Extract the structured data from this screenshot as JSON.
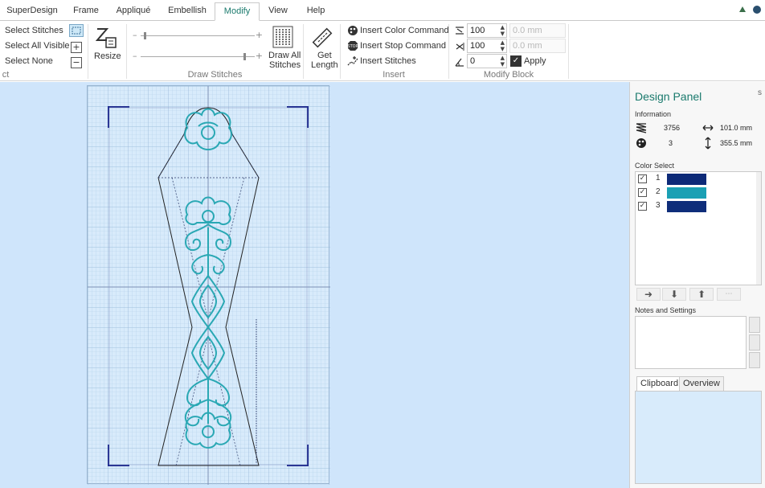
{
  "tabs": [
    {
      "label": "SuperDesign",
      "active": false
    },
    {
      "label": "Frame",
      "active": false
    },
    {
      "label": "Appliqué",
      "active": false
    },
    {
      "label": "Embellish",
      "active": false
    },
    {
      "label": "Modify",
      "active": true
    },
    {
      "label": "View",
      "active": false
    },
    {
      "label": "Help",
      "active": false
    }
  ],
  "ribbon": {
    "select": {
      "select_stitches": "Select Stitches",
      "select_all_visible": "Select All Visible",
      "select_none": "Select None",
      "group_label_fragment": "ct"
    },
    "resize_label": "Resize",
    "draw_all_stitches_line1": "Draw All",
    "draw_all_stitches_line2": "Stitches",
    "draw_stitches_group": "Draw Stitches",
    "get_length_line1": "Get",
    "get_length_line2": "Length",
    "insert_color_command": "Insert Color Command",
    "insert_stop_command": "Insert Stop Command",
    "insert_stitches": "Insert Stitches",
    "insert_group": "Insert",
    "modify_block": {
      "scale_x": "100",
      "scale_y": "100",
      "angle": "0",
      "offset_x": "0.0 mm",
      "offset_y": "0.0 mm",
      "apply_label": "Apply",
      "group_label": "Modify Block"
    }
  },
  "panel": {
    "title": "Design Panel",
    "information_label": "Information",
    "stitch_count": "3756",
    "width": "101.0 mm",
    "color_count": "3",
    "height": "355.5 mm",
    "color_select_label": "Color Select",
    "colors": [
      {
        "number": "1",
        "hex": "#0d2a78",
        "checked": true
      },
      {
        "number": "2",
        "hex": "#1aa0b4",
        "checked": true
      },
      {
        "number": "3",
        "hex": "#0e2d7a",
        "checked": true
      }
    ],
    "notes_label": "Notes and Settings",
    "bottom_tabs": [
      {
        "label": "Clipboard",
        "active": true
      },
      {
        "label": "Overview",
        "active": false
      }
    ]
  },
  "design": {
    "thread_color": "#2aa8b4",
    "hoop_color": "#1f2b8f"
  }
}
